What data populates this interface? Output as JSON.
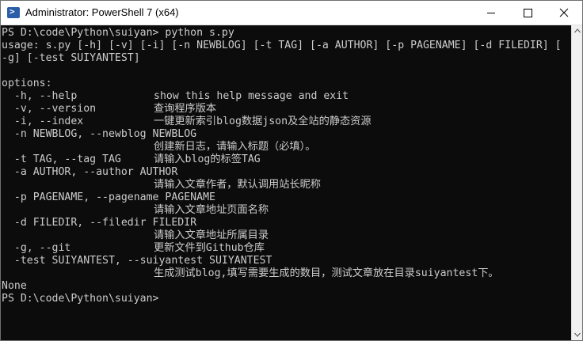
{
  "window": {
    "title": "Administrator: PowerShell 7 (x64)",
    "icon": "powershell-icon",
    "controls": [
      "minimize-icon",
      "maximize-icon",
      "close-icon"
    ]
  },
  "console": {
    "lines": [
      "PS D:\\code\\Python\\suiyan> python s.py",
      "usage: s.py [-h] [-v] [-i] [-n NEWBLOG] [-t TAG] [-a AUTHOR] [-p PAGENAME] [-d FILEDIR] [",
      "-g] [-test SUIYANTEST]",
      "",
      "options:"
    ],
    "options": [
      {
        "flag": "  -h, --help",
        "help": "show this help message and exit"
      },
      {
        "flag": "  -v, --version",
        "help": "查询程序版本"
      },
      {
        "flag": "  -i, --index",
        "help": "一键更新索引blog数据json及全站的静态资源"
      },
      {
        "flag": "  -n NEWBLOG, --newblog NEWBLOG",
        "help": ""
      },
      {
        "flag": "",
        "help": "创建新日志，请输入标题（必填）。"
      },
      {
        "flag": "  -t TAG, --tag TAG",
        "help": "请输入blog的标签TAG"
      },
      {
        "flag": "  -a AUTHOR, --author AUTHOR",
        "help": ""
      },
      {
        "flag": "",
        "help": "请输入文章作者，默认调用站长昵称"
      },
      {
        "flag": "  -p PAGENAME, --pagename PAGENAME",
        "help": ""
      },
      {
        "flag": "",
        "help": "请输入文章地址页面名称"
      },
      {
        "flag": "  -d FILEDIR, --filedir FILEDIR",
        "help": ""
      },
      {
        "flag": "",
        "help": "请输入文章地址所属目录"
      },
      {
        "flag": "  -g, --git",
        "help": "更新文件到Github仓库"
      },
      {
        "flag": "  -test SUIYANTEST, --suiyantest SUIYANTEST",
        "help": ""
      },
      {
        "flag": "",
        "help": "生成测试blog,填写需要生成的数目，测试文章放在目录suiyantest下。"
      }
    ],
    "trailing": [
      "None",
      "PS D:\\code\\Python\\suiyan>"
    ]
  },
  "colors": {
    "console_bg": "#0c0c0c",
    "console_fg": "#cccccc",
    "titlebar_bg": "#ffffff",
    "icon_bg": "#2c5ea8"
  }
}
